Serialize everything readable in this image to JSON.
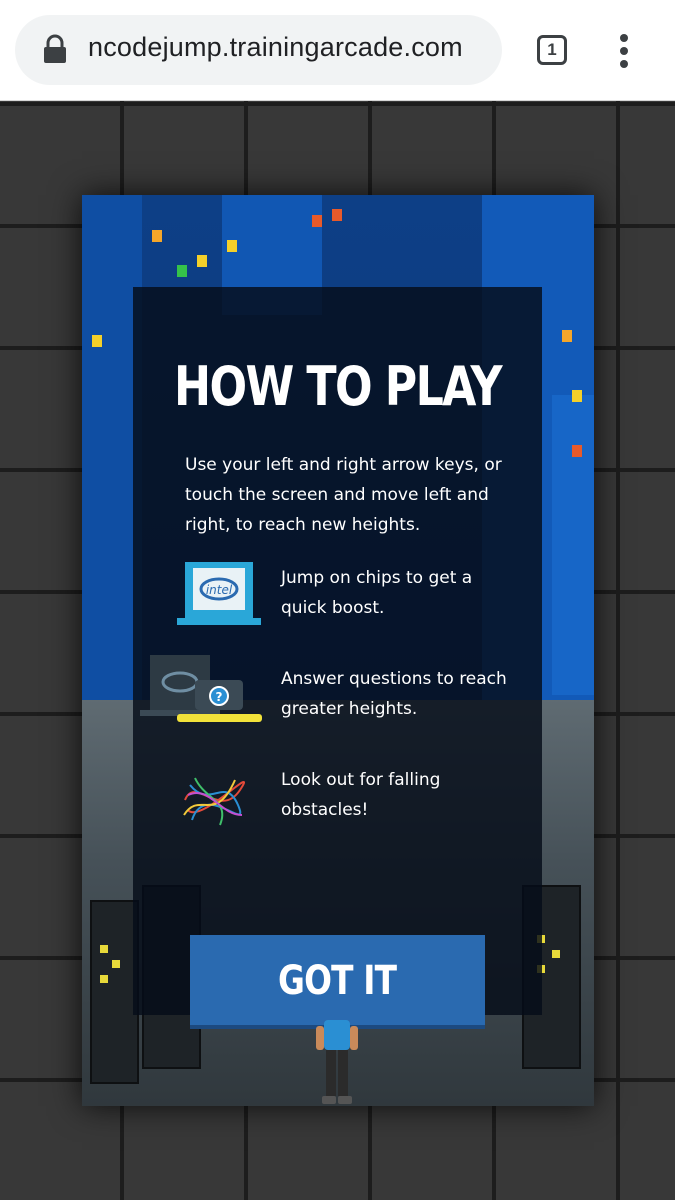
{
  "browser": {
    "url": "ncodejump.trainingarcade.com",
    "tab_count": "1"
  },
  "game": {
    "title": "HOW TO PLAY",
    "intro": "Use your left and right arrow keys, or touch the screen and move left and right, to reach new heights.",
    "tips": [
      {
        "icon": "chip-icon",
        "text": "Jump on chips to get a quick boost."
      },
      {
        "icon": "question-platform-icon",
        "text": "Answer questions to reach greater heights."
      },
      {
        "icon": "tangled-wires-icon",
        "text": "Look out for falling obstacles!"
      }
    ],
    "button_label": "GOT IT",
    "chip_logo_text": "intel"
  },
  "colors": {
    "button": "#2a6ab0",
    "background_tower": "#0f4ea3",
    "chip": "#2aa7d8"
  }
}
